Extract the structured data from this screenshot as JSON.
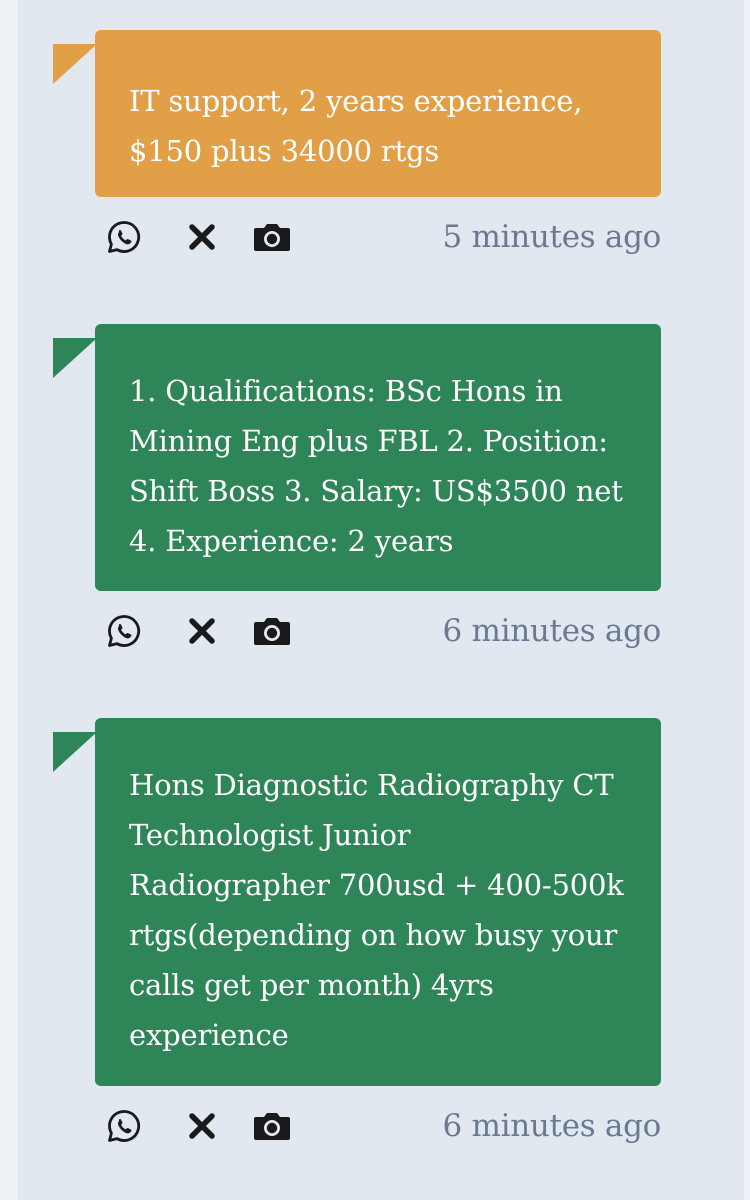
{
  "posts": [
    {
      "theme": "orange",
      "text": "IT support, 2 years experience,\n$150 plus 34000 rtgs",
      "time": "5 minutes ago"
    },
    {
      "theme": "green",
      "text": "1. Qualifications: BSc Hons in\nMining Eng plus FBL 2. Position:\nShift Boss 3. Salary: US$3500 net\n4. Experience: 2 years",
      "time": "6 minutes ago"
    },
    {
      "theme": "green",
      "text": "Hons Diagnostic Radiography CT\nTechnologist Junior\nRadiographer 700usd + 400-500k\nrtgs(depending on how busy your\ncalls get per month) 4yrs\nexperience",
      "time": "6 minutes ago"
    }
  ],
  "icons": {
    "share": "whatsapp-icon",
    "close": "close-icon",
    "screenshot": "camera-icon"
  },
  "colors": {
    "background": "#e2e8f0",
    "orange_bubble": "#e1a048",
    "green_bubble": "#2e8558",
    "timestamp": "#6b7a90",
    "icon": "#1a1a1a"
  }
}
